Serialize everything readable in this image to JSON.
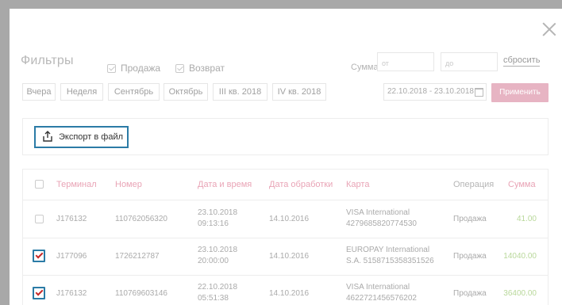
{
  "filters": {
    "title": "Фильтры",
    "sale_label": "Продажа",
    "return_label": "Возврат",
    "sum_label": "Сумма",
    "sum_from_placeholder": "от",
    "sum_to_placeholder": "до",
    "reset_label": "сбросить",
    "periods": [
      "Вчера",
      "Неделя",
      "Сентябрь",
      "Октябрь",
      "III кв. 2018",
      "IV кв. 2018"
    ],
    "date_range": "22.10.2018 - 23.10.2018",
    "apply_label": "Применить"
  },
  "export": {
    "label": "Экспорт в файл"
  },
  "table": {
    "headers": {
      "terminal": "Терминал",
      "number": "Номер",
      "datetime": "Дата и время",
      "processed": "Дата обработки",
      "card": "Карта",
      "operation": "Операция",
      "amount": "Сумма"
    },
    "rows": [
      {
        "checked": false,
        "terminal": "J176132",
        "number": "110762056320",
        "date": "23.10.2018",
        "time": "09:13:16",
        "processed": "14.10.2016",
        "card_line1": "VISA International",
        "card_line2": "4279685820774530",
        "operation": "Продажа",
        "amount": "41.00"
      },
      {
        "checked": true,
        "terminal": "J177096",
        "number": "1726212787",
        "date": "23.10.2018",
        "time": "20:00:00",
        "processed": "14.10.2016",
        "card_line1": "EUROPAY International",
        "card_line2": "S.A. 5158715358351526",
        "operation": "Продажа",
        "amount": "14040.00"
      },
      {
        "checked": true,
        "terminal": "J176132",
        "number": "110769603146",
        "date": "22.10.2018",
        "time": "05:51:38",
        "processed": "14.10.2016",
        "card_line1": "VISA International",
        "card_line2": "4622721456576202",
        "operation": "Продажа",
        "amount": "36400.00"
      }
    ]
  }
}
